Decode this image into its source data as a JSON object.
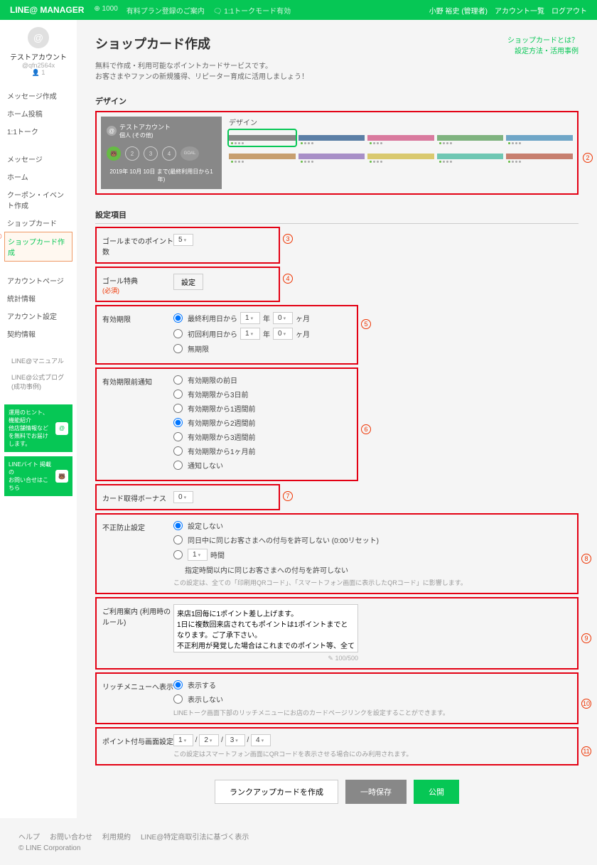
{
  "top": {
    "brand": "LINE@ MANAGER",
    "status1": "⊕ 1000",
    "status2": "有料プラン登録のご案内",
    "status3": "🗨 1:1トークモード有効",
    "user": "小野 裕史 (管理者)",
    "accounts": "アカウント一覧",
    "logout": "ログアウト"
  },
  "profile": {
    "name": "テストアカウント",
    "id": "@qfn2564x",
    "followers": "👤 1"
  },
  "side": {
    "g1": [
      "メッセージ作成",
      "ホーム投稿",
      "1:1トーク"
    ],
    "g2": [
      "メッセージ",
      "ホーム",
      "クーポン・イベント作成",
      "ショップカード"
    ],
    "active": "ショップカード作成",
    "g3": [
      "アカウントページ",
      "統計情報",
      "アカウント設定",
      "契約情報"
    ],
    "g4": [
      "LINE@マニュアル",
      "LINE@公式ブログ (成功事例)"
    ],
    "promo1": "運用のヒント、機能紹介\n他店舗情報などを無料でお届けします。",
    "promo2": "LINEバイト 掲載の\nお問い合せはこちら"
  },
  "page": {
    "title": "ショップカード作成",
    "link1": "ショップカードとは？",
    "link2": "設定方法・活用事例",
    "desc": "無料で作成・利用可能なポイントカードサービスです。\nお客さまやファンの新規獲得、リピーター育成に活用しましょう！",
    "design": "デザイン",
    "preview_name": "テストアカウント",
    "preview_sub": "個人 (その他)",
    "preview_date": "2019年 10月 10日 まで(最終利用日から1年)",
    "themes_label": "デザイン",
    "settings": "設定項目"
  },
  "rows": {
    "points": "ゴールまでのポイント数",
    "points_val": "5",
    "goal": "ゴール特典",
    "goal_req": "(必須)",
    "goal_btn": "設定",
    "expire": "有効期限",
    "exp_opt1": "最終利用日から",
    "exp_opt2": "初回利用日から",
    "exp_opt3": "無期限",
    "year": "年",
    "month": "ヶ月",
    "notify": "有効期限前通知",
    "notify_opts": [
      "有効期限の前日",
      "有効期限から3日前",
      "有効期限から1週間前",
      "有効期限から2週間前",
      "有効期限から3週間前",
      "有効期限から1ヶ月前",
      "通知しない"
    ],
    "bonus": "カード取得ボーナス",
    "bonus_val": "0",
    "fraud": "不正防止設定",
    "fraud_opt1": "設定しない",
    "fraud_opt2": "同日中に同じお客さまへの付与を許可しない (0:00リセット)",
    "fraud_opt3a": "時間",
    "fraud_opt3b": "指定時間以内に同じお客さまへの付与を許可しない",
    "fraud_note": "この設定は、全ての「印刷用QRコード」、「スマートフォン画面に表示したQRコード」に影響します。",
    "guide": "ご利用案内 (利用時のルール)",
    "guide_text": "来店1回毎に1ポイント差し上げます。\n1日に複数回来店されてもポイントは1ポイントまでとなります。ご了承下さい。\n不正利用が発覚した場合はこれまでのポイント等、全て無効とさせていただくことがあります。",
    "guide_count": "100/500",
    "rich": "リッチメニューへ表示",
    "rich_opt1": "表示する",
    "rich_opt2": "表示しない",
    "rich_note": "LINEトーク画面下部のリッチメニューにお店のカードページリンクを設定することができます。",
    "grant": "ポイント付与画面設定",
    "grant_note": "この設定はスマートフォン画面にQRコードを表示させる場合にのみ利用されます。"
  },
  "buttons": {
    "rank": "ランクアップカードを作成",
    "save": "一時保存",
    "publish": "公開"
  },
  "footer": {
    "links": [
      "ヘルプ",
      "お問い合わせ",
      "利用規約",
      "LINE@特定商取引法に基づく表示"
    ],
    "copy": "© LINE Corporation"
  },
  "theme_colors": [
    "#888888",
    "#5b7fa6",
    "#d97a9e",
    "#7fb37f",
    "#6fa6c7",
    "#c79f6f",
    "#a88fc7",
    "#d9c96f",
    "#6fc7b3",
    "#c77f6f"
  ]
}
